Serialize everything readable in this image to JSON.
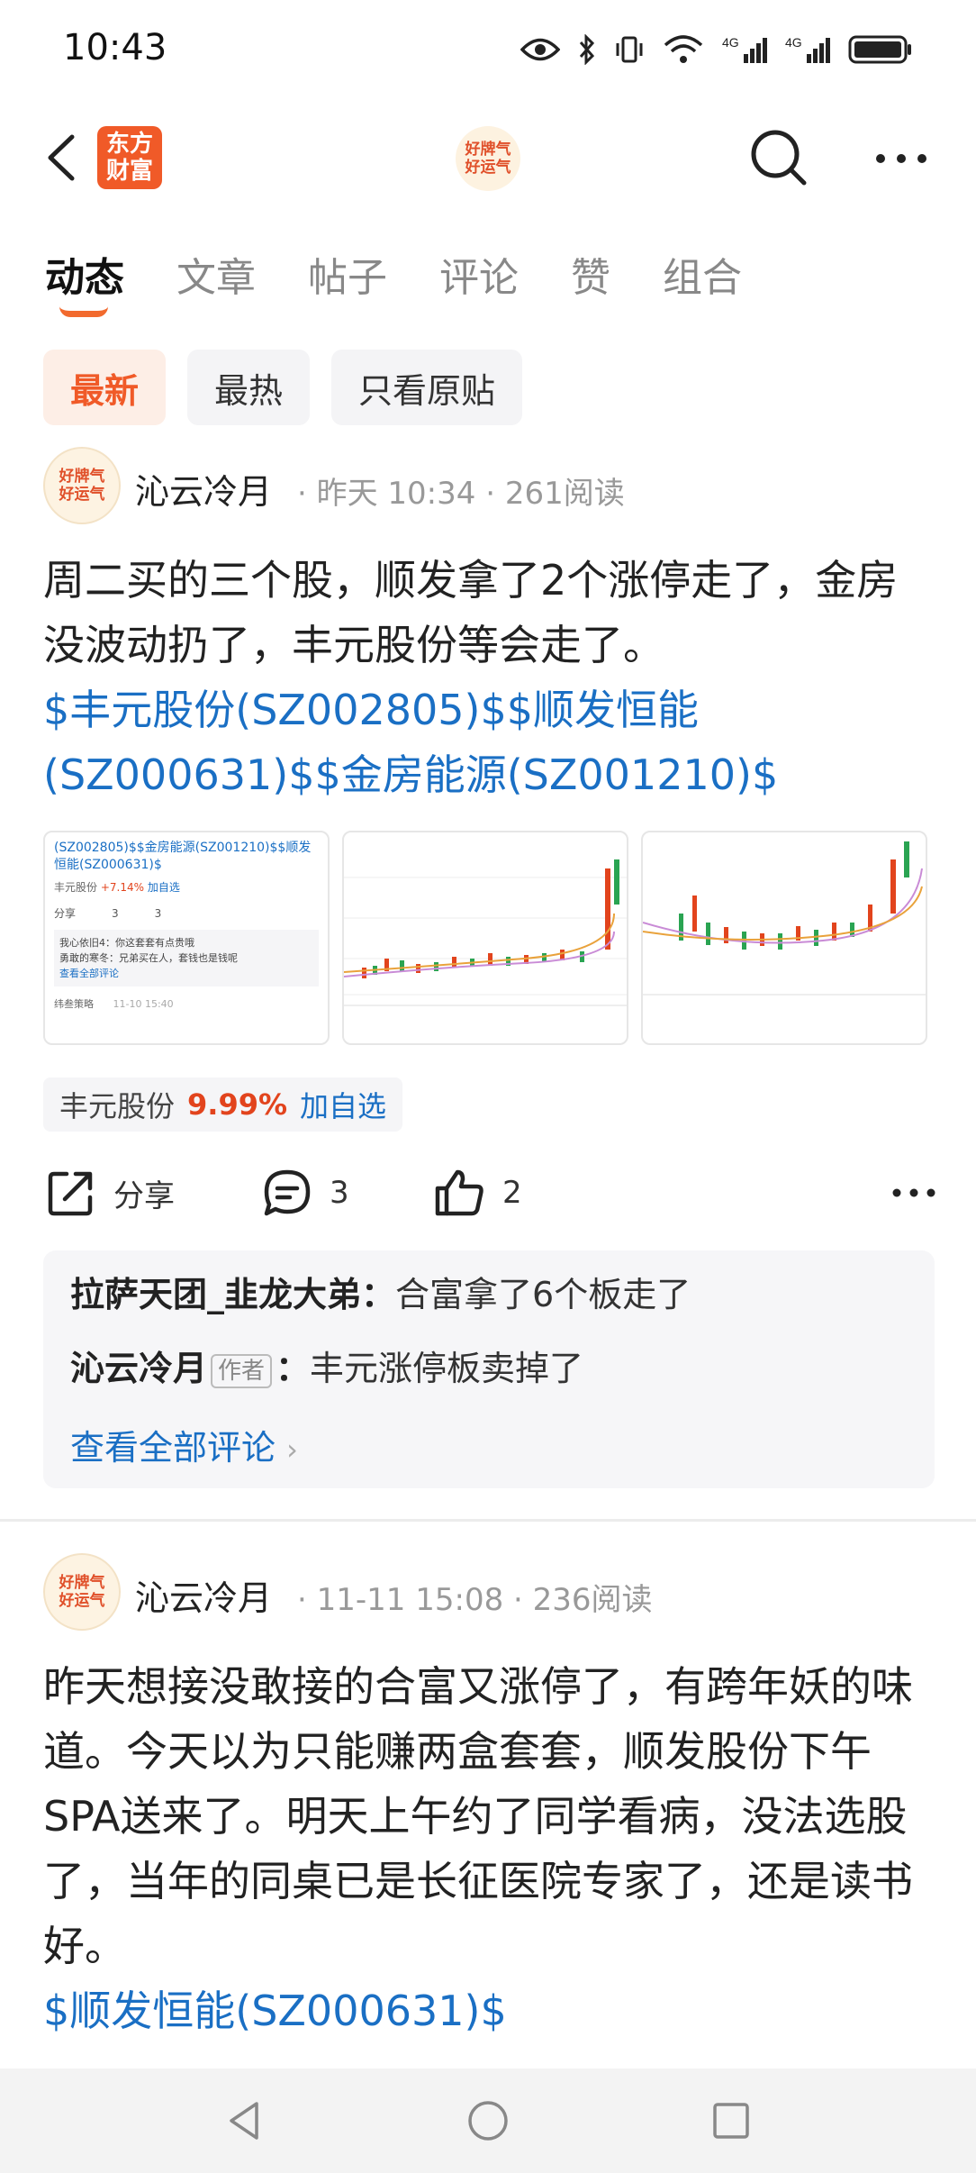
{
  "status": {
    "time": "10:43"
  },
  "app": {
    "badge": "东方\n财富",
    "badge_line1": "东方",
    "badge_line2": "财富",
    "avatar_line1": "好牌气",
    "avatar_line2": "好运气"
  },
  "tabs": [
    {
      "label": "动态",
      "active": true
    },
    {
      "label": "文章",
      "active": false
    },
    {
      "label": "帖子",
      "active": false
    },
    {
      "label": "评论",
      "active": false
    },
    {
      "label": "赞",
      "active": false
    },
    {
      "label": "组合",
      "active": false
    }
  ],
  "filters": [
    {
      "label": "最新",
      "active": true
    },
    {
      "label": "最热",
      "active": false
    },
    {
      "label": "只看原贴",
      "active": false
    }
  ],
  "posts": [
    {
      "author": "沁云冷月",
      "meta": "· 昨天 10:34 · 261阅读",
      "text": "周二买的三个股，顺发拿了2个涨停走了，金房没波动扔了，丰元股份等会走了。",
      "links": "$丰元股份(SZ002805)$$顺发恒能(SZ000631)$$金房能源(SZ001210)$",
      "stock_tag": {
        "name": "丰元股份",
        "pct": "9.99%",
        "add": "加自选"
      },
      "share_label": "分享",
      "comment_count": "3",
      "like_count": "2",
      "comments": [
        {
          "user": "拉萨天团_韭龙大弟",
          "text": "合富拿了6个板走了",
          "is_author": false
        },
        {
          "user": "沁云冷月",
          "author_tag": "作者",
          "text": "丰元涨停板卖掉了",
          "is_author": true
        }
      ],
      "view_all": "查看全部评论"
    },
    {
      "author": "沁云冷月",
      "meta": "· 11-11 15:08 · 236阅读",
      "text": "昨天想接没敢接的合富又涨停了，有跨年妖的味道。今天以为只能赚两盒套套，顺发股份下午SPA送来了。明天上午约了同学看病，没法选股了，当年的同桌已是长征医院专家了，还是读书好。",
      "links": "$顺发恒能(SZ000631)$"
    }
  ],
  "thumb1": {
    "line1": "(SZ002805)$$金房能源(SZ001210)$$顺发",
    "line2": "恒能(SZ000631)$",
    "stock": "丰元股份",
    "pct": "+7.14%",
    "add": "加自选",
    "share": "分享",
    "c": "3",
    "l": "3",
    "reply1": "我心依旧4：你这套套有点贵哦",
    "reply2": "勇敢的寒冬：兄弟买在人，套钱也是钱呢",
    "view": "查看全部评论",
    "footer": "纬叁策略",
    "date": "11-10 15:40"
  },
  "colors": {
    "accent": "#f05a28",
    "link": "#1a6fc4",
    "up": "#e2441d"
  }
}
